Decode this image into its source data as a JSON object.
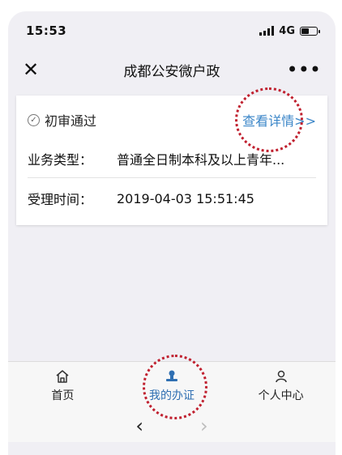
{
  "status_bar": {
    "time": "15:53",
    "network": "4G",
    "battery_level": 0.45
  },
  "nav": {
    "title": "成都公安微户政",
    "close_icon": "close-icon",
    "more_icon": "more-dots-icon"
  },
  "card": {
    "status": "初审通过",
    "detail_link": "查看详情>>",
    "fields": [
      {
        "label": "业务类型：",
        "value": "普通全日制本科及以上青年..."
      },
      {
        "label": "受理时间：",
        "value": "2019-04-03 15:51:45"
      }
    ]
  },
  "tabbar": {
    "items": [
      {
        "label": "首页",
        "icon": "home-icon",
        "active": false
      },
      {
        "label": "我的办证",
        "icon": "stamp-icon",
        "active": true
      },
      {
        "label": "个人中心",
        "icon": "person-icon",
        "active": false
      }
    ]
  },
  "browser": {
    "back_icon": "chevron-left-icon",
    "forward_icon": "chevron-right-icon"
  },
  "colors": {
    "accent": "#3b86c8",
    "annotation": "#c0202f",
    "active_tab": "#2f6fb2"
  }
}
